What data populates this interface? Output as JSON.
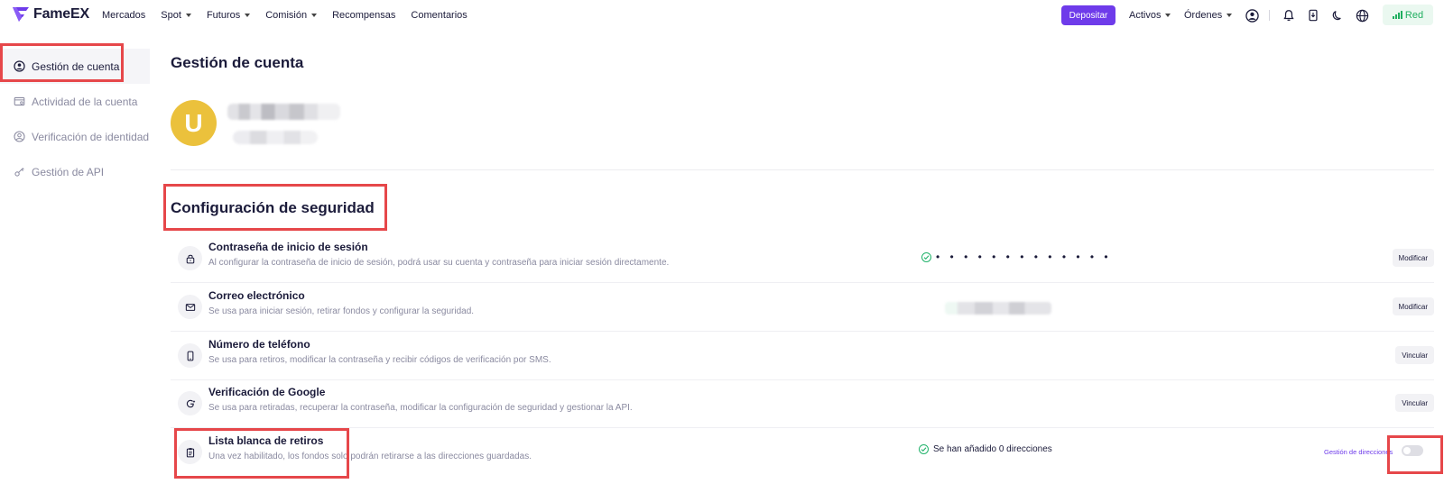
{
  "header": {
    "logo_text": "FameEX",
    "nav": [
      {
        "label": "Mercados",
        "dropdown": false
      },
      {
        "label": "Spot",
        "dropdown": true
      },
      {
        "label": "Futuros",
        "dropdown": true
      },
      {
        "label": "Comisión",
        "dropdown": true
      },
      {
        "label": "Recompensas",
        "dropdown": false
      },
      {
        "label": "Comentarios",
        "dropdown": false
      }
    ],
    "deposit_label": "Depositar",
    "assets_label": "Activos",
    "orders_label": "Órdenes",
    "network_label": "Red"
  },
  "sidebar": {
    "items": [
      {
        "label": "Gestión de cuenta",
        "icon": "user-circle-icon",
        "active": true
      },
      {
        "label": "Actividad de la cuenta",
        "icon": "activity-card-icon",
        "active": false
      },
      {
        "label": "Verificación de identidad",
        "icon": "id-verify-icon",
        "active": false
      },
      {
        "label": "Gestión de API",
        "icon": "api-key-icon",
        "active": false
      }
    ]
  },
  "main": {
    "page_title": "Gestión de cuenta",
    "avatar_letter": "U",
    "security_title": "Configuración de seguridad",
    "rows": [
      {
        "title": "Contraseña de inicio de sesión",
        "desc": "Al configurar la contraseña de inicio de sesión, podrá usar su cuenta y contraseña para iniciar sesión directamente.",
        "status": "• • • • • • • • • • • • •",
        "action": "Modificar",
        "icon": "lock-icon"
      },
      {
        "title": "Correo electrónico",
        "desc": "Se usa para iniciar sesión, retirar fondos y configurar la seguridad.",
        "action": "Modificar",
        "icon": "mail-icon"
      },
      {
        "title": "Número de teléfono",
        "desc": "Se usa para retiros, modificar la contraseña y recibir códigos de verificación por SMS.",
        "action": "Vincular",
        "icon": "phone-icon"
      },
      {
        "title": "Verificación de Google",
        "desc": "Se usa para retiradas, recuperar la contraseña, modificar la configuración de seguridad y gestionar la API.",
        "action": "Vincular",
        "icon": "google-icon"
      },
      {
        "title": "Lista blanca de retiros",
        "desc": "Una vez habilitado, los fondos solo podrán retirarse a las direcciones guardadas.",
        "status": "Se han añadido 0 direcciones",
        "link": "Gestión de direcciones",
        "toggle_on": false,
        "icon": "clipboard-icon"
      }
    ]
  },
  "colors": {
    "accent": "#6e3bea",
    "avatar": "#ebc13c",
    "success": "#22b36b",
    "annotation": "#e6474a"
  }
}
